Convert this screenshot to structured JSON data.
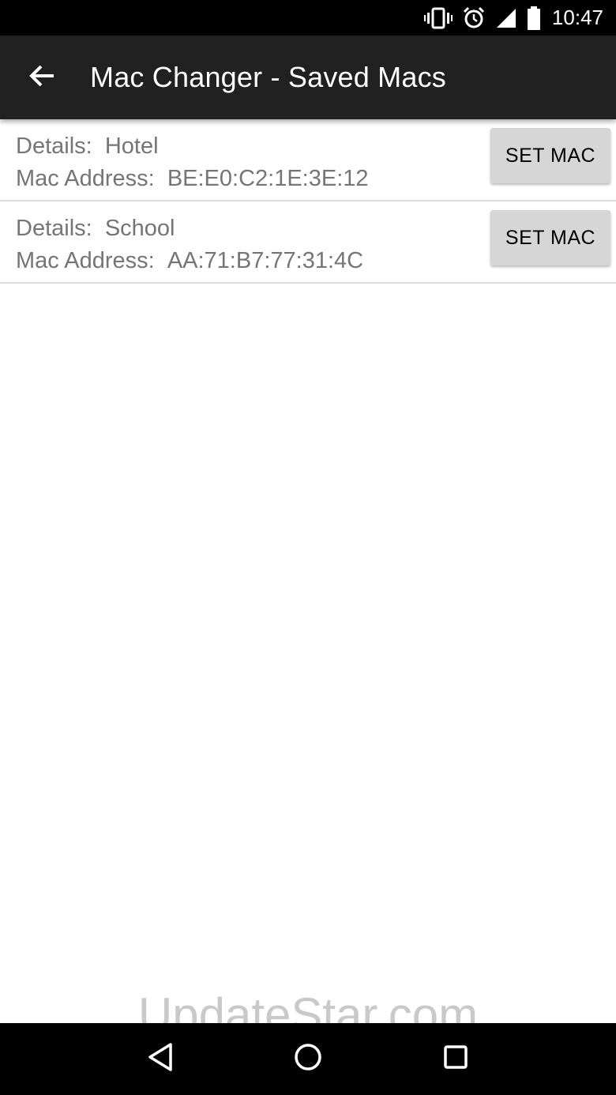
{
  "status_bar": {
    "time": "10:47",
    "icons": [
      "vibrate-icon",
      "alarm-icon",
      "signal-icon",
      "battery-icon"
    ]
  },
  "app_bar": {
    "back_icon": "arrow-back-icon",
    "title": "Mac Changer - Saved Macs"
  },
  "saved_macs": [
    {
      "details_label": "Details:",
      "details_value": "Hotel",
      "mac_label": "Mac Address:",
      "mac_value": "BE:E0:C2:1E:3E:12",
      "button_label": "SET MAC"
    },
    {
      "details_label": "Details:",
      "details_value": "School",
      "mac_label": "Mac Address:",
      "mac_value": "AA:71:B7:77:31:4C",
      "button_label": "SET MAC"
    }
  ],
  "watermark": "UpdateStar.com",
  "nav_bar": {
    "icons": [
      "nav-back-icon",
      "nav-home-icon",
      "nav-recents-icon"
    ]
  },
  "colors": {
    "app_bar": "#212121",
    "status_bar": "#000000",
    "button": "#d6d6d6",
    "secondary_text": "#757575"
  }
}
